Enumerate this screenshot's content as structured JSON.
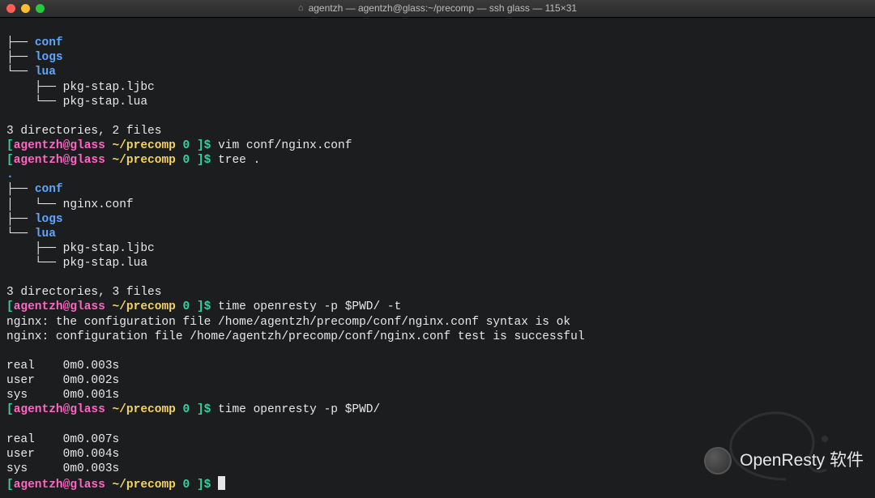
{
  "window": {
    "title": "agentzh — agentzh@glass:~/precomp — ssh glass — 115×31"
  },
  "prompt": {
    "open": "[",
    "user_host": "agentzh@glass",
    "path": " ~/precomp",
    "status": " 0 ",
    "close": "]",
    "dollar": "$ "
  },
  "tree1": {
    "l1": "├── ",
    "l1name": "conf",
    "l2": "├── ",
    "l2name": "logs",
    "l3": "└── ",
    "l3name": "lua",
    "l4": "    ├── pkg-stap.ljbc",
    "l5": "    └── pkg-stap.lua",
    "summary": "3 directories, 2 files"
  },
  "cmd1": "vim conf/nginx.conf",
  "cmd2": "tree .",
  "dot": ".",
  "tree2": {
    "l1": "├── ",
    "l1name": "conf",
    "l2": "│   └── nginx.conf",
    "l3": "├── ",
    "l3name": "logs",
    "l4": "└── ",
    "l4name": "lua",
    "l5": "    ├── pkg-stap.ljbc",
    "l6": "    └── pkg-stap.lua",
    "summary": "3 directories, 3 files"
  },
  "cmd3": "time openresty -p $PWD/ -t",
  "nginx1": "nginx: the configuration file /home/agentzh/precomp/conf/nginx.conf syntax is ok",
  "nginx2": "nginx: configuration file /home/agentzh/precomp/conf/nginx.conf test is successful",
  "time1": {
    "real": "real    0m0.003s",
    "user": "user    0m0.002s",
    "sys": "sys     0m0.001s"
  },
  "cmd4": "time openresty -p $PWD/",
  "time2": {
    "real": "real    0m0.007s",
    "user": "user    0m0.004s",
    "sys": "sys     0m0.003s"
  },
  "watermark": "OpenResty 软件"
}
